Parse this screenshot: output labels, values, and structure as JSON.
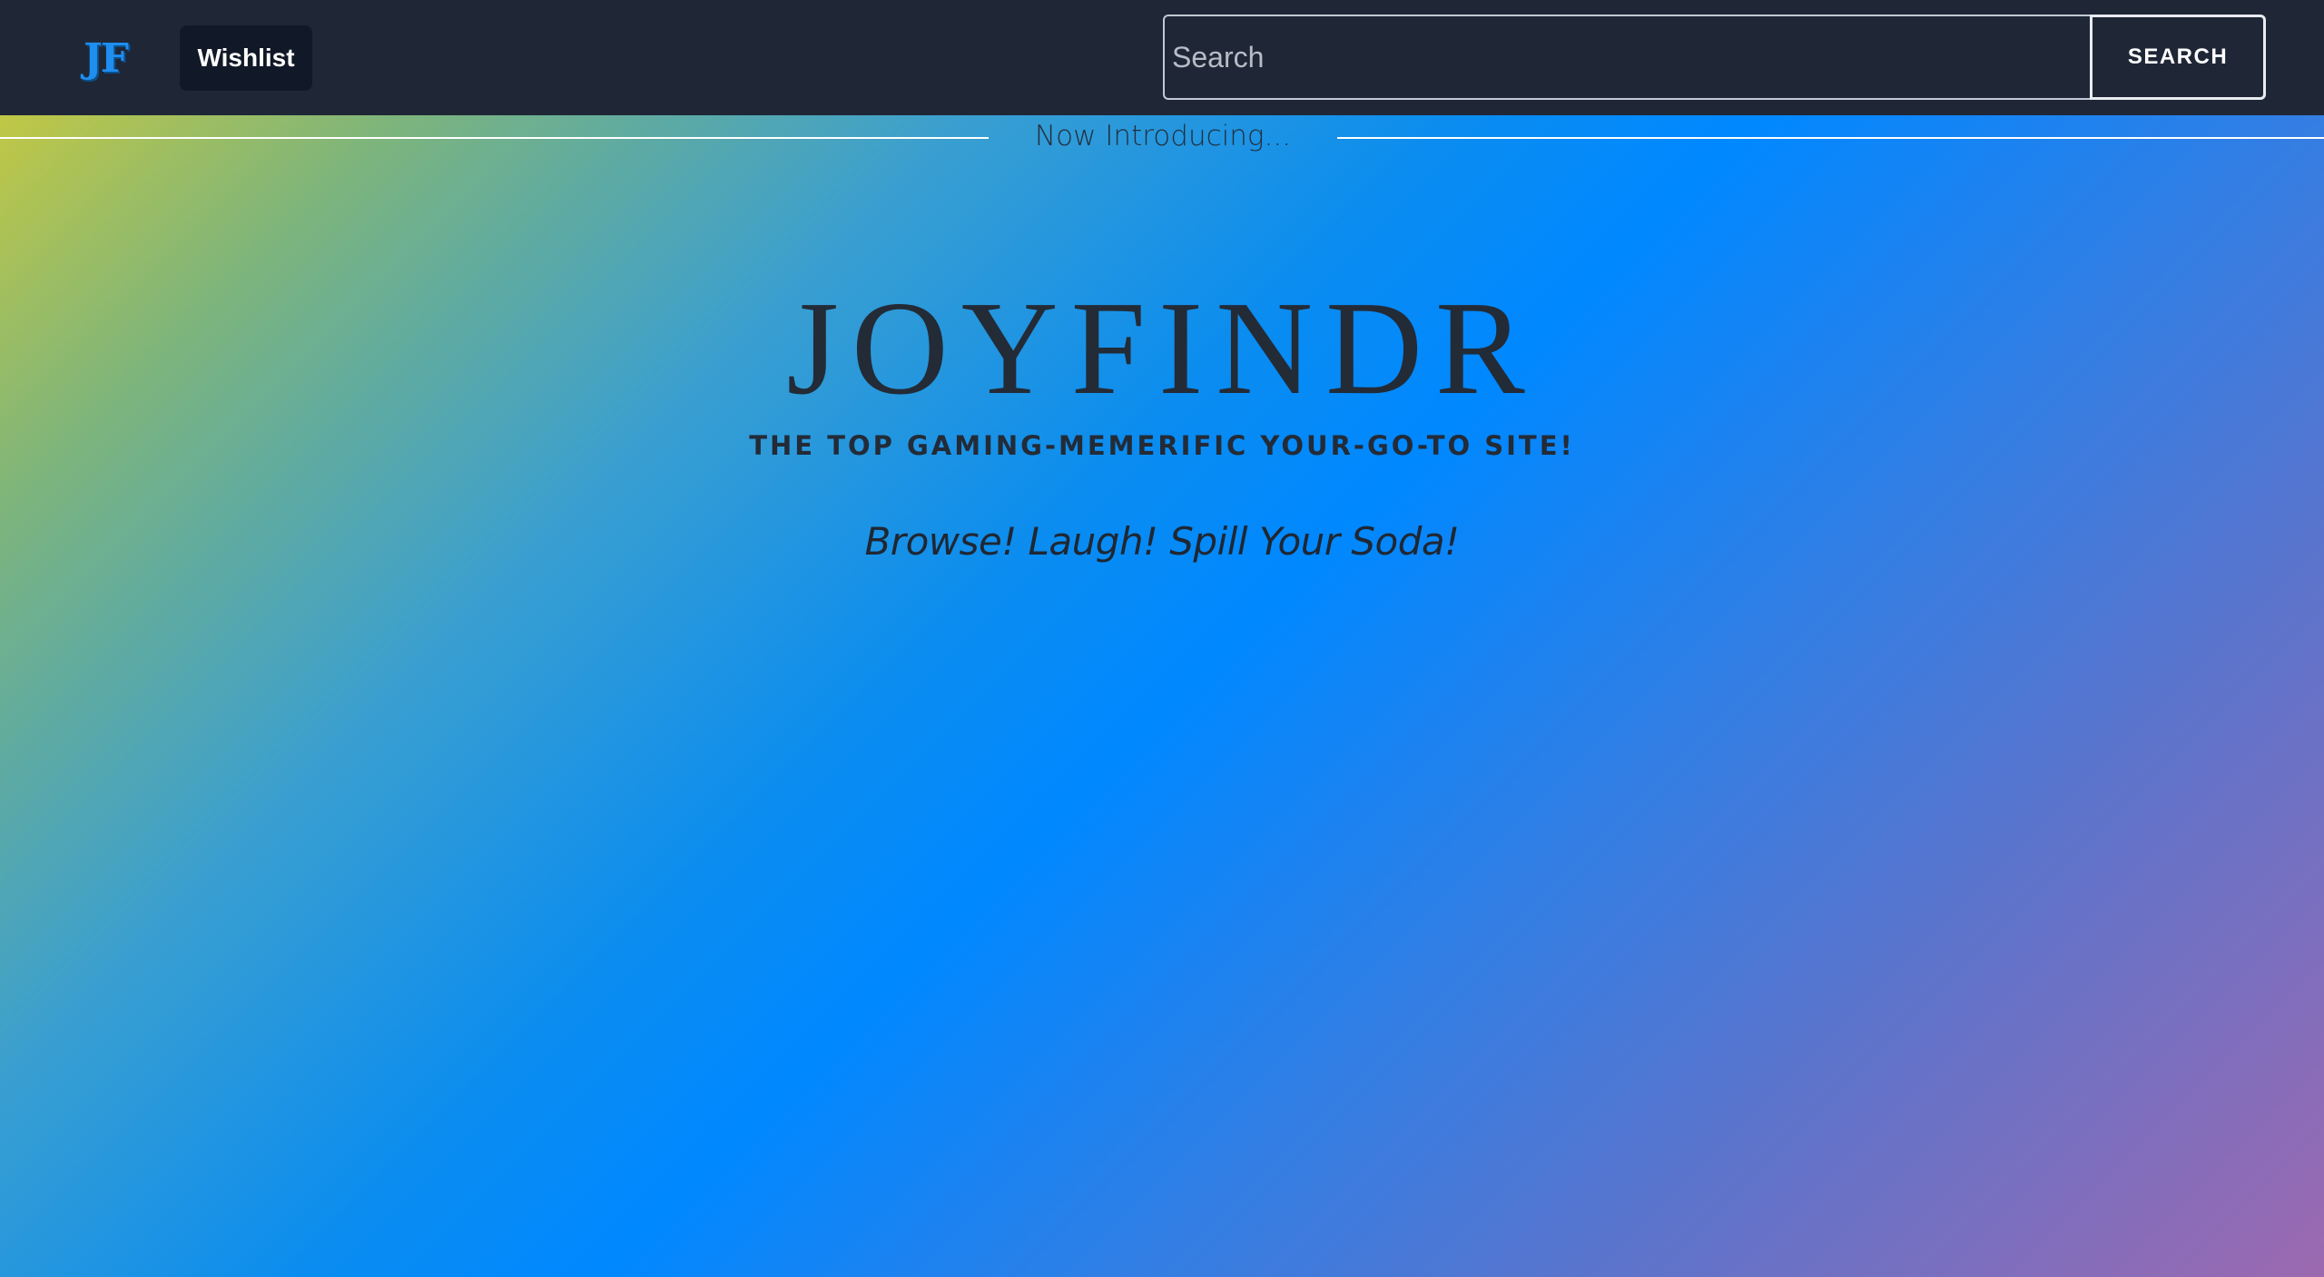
{
  "navbar": {
    "brand": "JF",
    "wishlist_label": "Wishlist",
    "search_placeholder": "Search",
    "search_value": "",
    "search_button_label": "SEARCH"
  },
  "intro": {
    "text": "Now Introducing..."
  },
  "hero": {
    "title": "JOYFINDR",
    "subtitle": "THE TOP GAMING-MEMERIFIC YOUR-GO-TO SITE!",
    "tagline": "Browse! Laugh! Spill Your Soda!"
  },
  "colors": {
    "navbar_bg": "#1f2737",
    "brand_accent": "#1e8ef0",
    "gradient": [
      "#d4cd36",
      "#0088ff",
      "#9d69b0"
    ],
    "hero_text": "#232b37"
  }
}
